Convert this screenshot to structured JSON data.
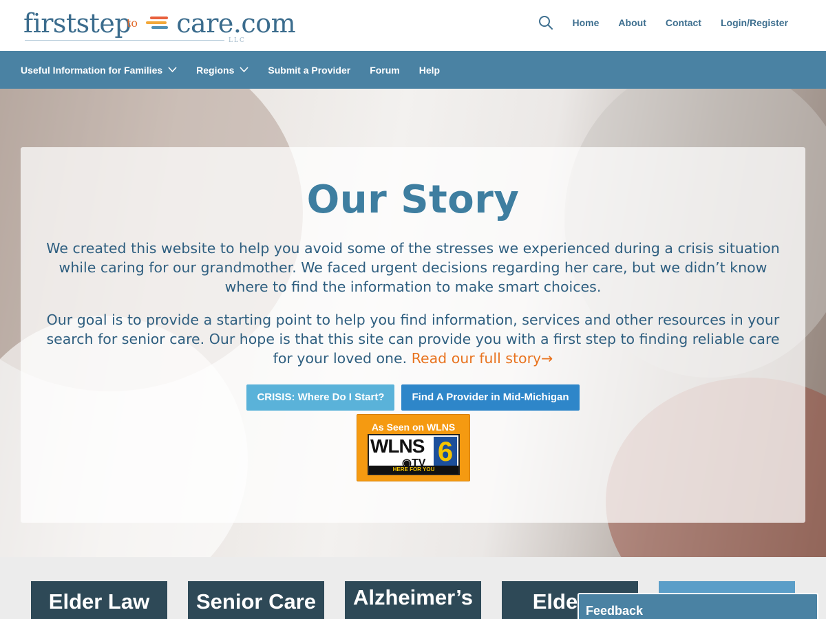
{
  "header": {
    "logo": {
      "main": "firststep care.com",
      "left": "firststep",
      "to": "to",
      "right": "care.com",
      "llc": "LLC"
    },
    "search_icon": "search-icon",
    "nav": [
      {
        "label": "Home"
      },
      {
        "label": "About"
      },
      {
        "label": "Contact"
      },
      {
        "label": "Login/Register"
      }
    ]
  },
  "mainnav": {
    "items": [
      {
        "label": "Useful Information for Families",
        "has_dropdown": true
      },
      {
        "label": "Regions",
        "has_dropdown": true
      },
      {
        "label": "Submit a Provider",
        "has_dropdown": false
      },
      {
        "label": "Forum",
        "has_dropdown": false
      },
      {
        "label": "Help",
        "has_dropdown": false
      }
    ]
  },
  "hero": {
    "title": "Our Story",
    "paragraph1": "We created this website to help you avoid some of the stresses we experienced during a crisis situation while caring for our grandmother. We faced urgent decisions regarding her care, but we didn’t know where to find the information to make smart choices.",
    "paragraph2": "Our goal is to provide a starting point to help you find information, services and other resources in your search for senior care. Our hope is that this site can provide you with a first step to finding reliable care for your loved one. ",
    "read_more": "Read our full story→",
    "buttons": {
      "crisis": "CRISIS: Where Do I Start?",
      "find": "Find A Provider in Mid-Michigan"
    },
    "badge": {
      "heading": "As Seen on WLNS",
      "station": "WLNS",
      "tv": "TV",
      "channel": "6",
      "tagline": "HERE FOR YOU"
    }
  },
  "tiles": [
    {
      "label": "Elder Law"
    },
    {
      "label": "Senior Care"
    },
    {
      "label": "Alzheimer’s"
    },
    {
      "label": "Elder C"
    },
    {
      "label": ""
    }
  ],
  "feedback": {
    "label": "Feedback"
  },
  "colors": {
    "brand_blue": "#4a82a3",
    "title_blue": "#3e7ea0",
    "text_blue": "#2f5f80",
    "accent_orange": "#e8731f",
    "crisis_button": "#5ab2d9",
    "find_button": "#2e86c9",
    "tile_dark": "#2e4957"
  }
}
